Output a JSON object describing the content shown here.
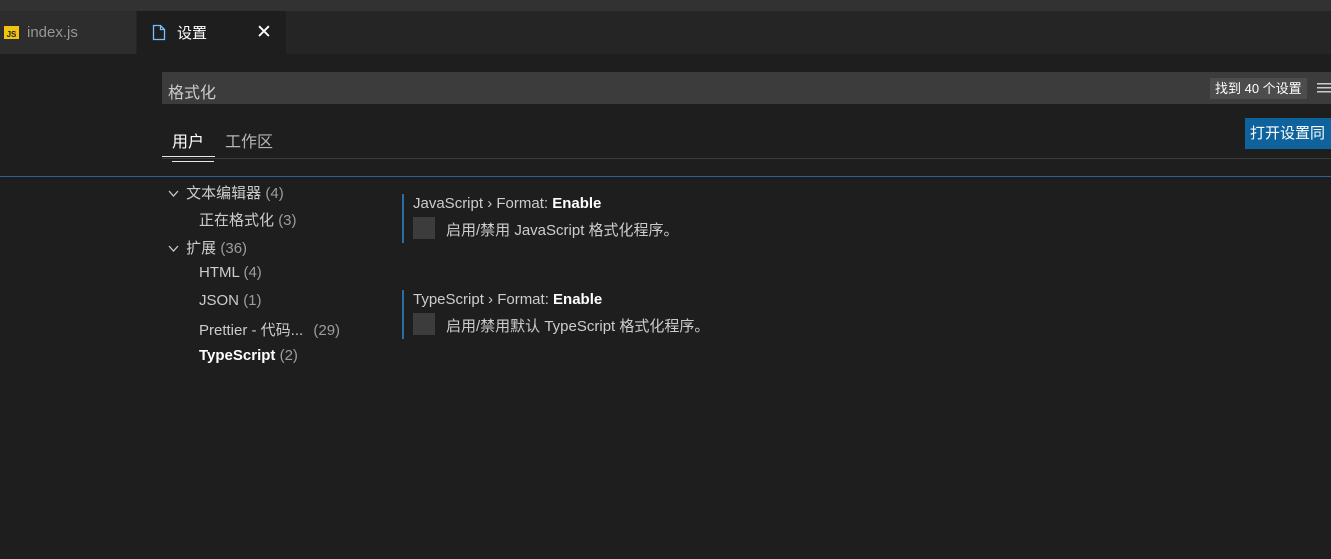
{
  "tabs": [
    {
      "label": "index.js",
      "icon": "javascript-file-icon",
      "active": false
    },
    {
      "label": "设置",
      "icon": "file-icon",
      "active": true
    }
  ],
  "search": {
    "value": "格式化",
    "result_count": "找到 40 个设置"
  },
  "scope_tabs": {
    "user": "用户",
    "workspace": "工作区"
  },
  "open_settings_button": "打开设置同",
  "toc": [
    {
      "label": "文本编辑器",
      "count": "(4)",
      "chevron": "v"
    },
    {
      "label": "正在格式化",
      "count": "(3)"
    },
    {
      "label": "扩展",
      "count": "(36)",
      "chevron": "v"
    },
    {
      "label": "HTML",
      "count": "(4)"
    },
    {
      "label": "JSON",
      "count": "(1)"
    },
    {
      "label": "Prettier - 代码...",
      "count": "(29)"
    },
    {
      "label": "TypeScript",
      "count": "(2)",
      "selected": true
    }
  ],
  "settings": [
    {
      "category": "JavaScript › Format: ",
      "name": "Enable",
      "description": "启用/禁用 JavaScript 格式化程序。",
      "checked": false
    },
    {
      "category": "TypeScript › Format: ",
      "name": "Enable",
      "description": "启用/禁用默认 TypeScript 格式化程序。",
      "checked": false
    }
  ],
  "colors": {
    "accent": "#0e639c",
    "background": "#1e1e1e",
    "setting_bar": "#2b6ea3"
  }
}
